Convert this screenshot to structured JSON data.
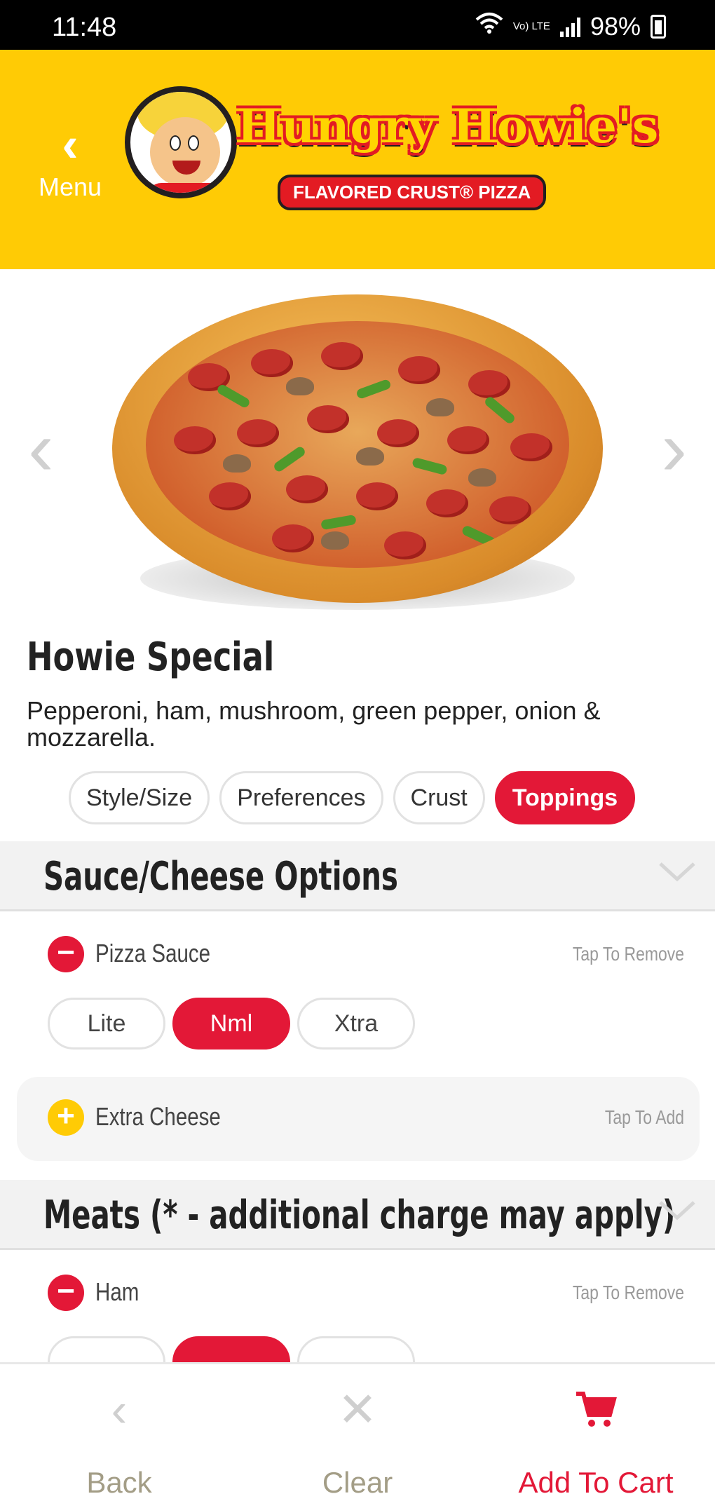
{
  "status_bar": {
    "time": "11:48",
    "network": "Vo) LTE",
    "battery": "98%"
  },
  "header": {
    "back_label": "Menu",
    "logo_text": "Hungry Howie's",
    "logo_tagline": "FLAVORED CRUST® PIZZA",
    "bg_color": "#ffcb05"
  },
  "product": {
    "title": "Howie Special",
    "description": "Pepperoni, ham, mushroom, green pepper, onion & mozzarella."
  },
  "tabs": [
    {
      "label": "Style/Size",
      "active": false
    },
    {
      "label": "Preferences",
      "active": false
    },
    {
      "label": "Crust",
      "active": false
    },
    {
      "label": "Toppings",
      "active": true
    }
  ],
  "sections": {
    "sauce_cheese": {
      "title": "Sauce/Cheese Options",
      "pizza_sauce": {
        "label": "Pizza Sauce",
        "hint": "Tap To Remove",
        "levels": [
          "Lite",
          "Nml",
          "Xtra"
        ],
        "selected": "Nml"
      },
      "extra_cheese": {
        "label": "Extra Cheese",
        "hint": "Tap To Add"
      }
    },
    "meats": {
      "title": "Meats (* - additional charge may apply)",
      "ham": {
        "label": "Ham",
        "hint": "Tap To Remove"
      }
    }
  },
  "bottom_bar": {
    "back": "Back",
    "clear": "Clear",
    "add_to_cart": "Add To Cart"
  },
  "colors": {
    "accent": "#e31837",
    "brand_yellow": "#ffcb05"
  }
}
